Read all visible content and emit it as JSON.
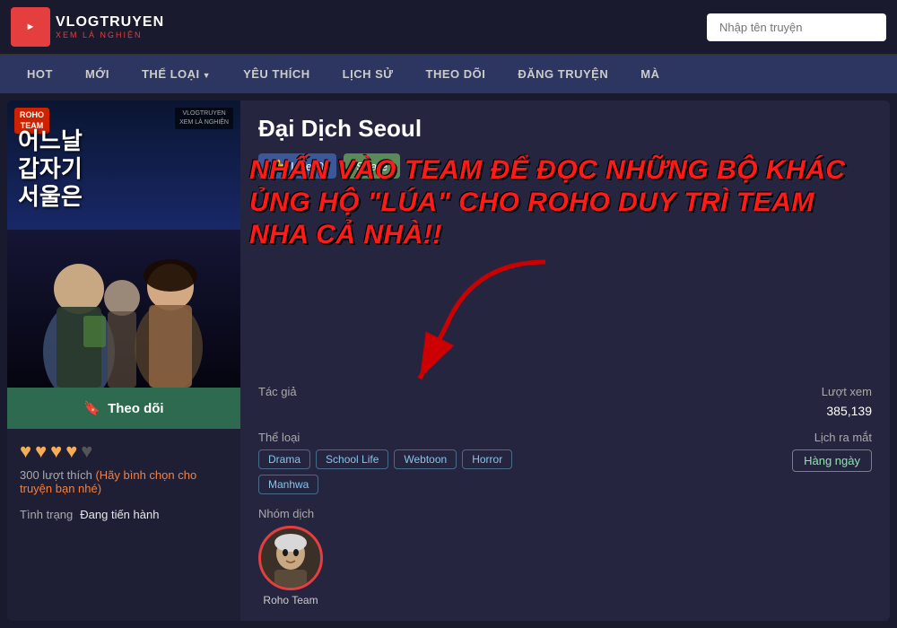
{
  "header": {
    "logo_line1": "VLOGTRUYEN",
    "logo_line2": "XEM LÀ NGHIỆN",
    "search_placeholder": "Nhập tên truyện"
  },
  "nav": {
    "items": [
      {
        "label": "HOT",
        "arrow": false
      },
      {
        "label": "MỚI",
        "arrow": false
      },
      {
        "label": "THỂ LOẠI",
        "arrow": true
      },
      {
        "label": "YÊU THÍCH",
        "arrow": false
      },
      {
        "label": "LỊCH SỬ",
        "arrow": false
      },
      {
        "label": "THEO DÕI",
        "arrow": false
      },
      {
        "label": "ĐĂNG TRUYỆN",
        "arrow": false
      },
      {
        "label": "MÀ",
        "arrow": false
      }
    ]
  },
  "manga": {
    "title": "Đại Dịch Seoul",
    "like_btn_label": "Like",
    "like_count": "0",
    "share_btn_label": "Share",
    "promo_text": "NHẤN VÀO TEAM ĐỂ ĐỌC NHỮNG BỘ KHÁC ỦNG HỘ \"LÚA\" CHO ROHO DUY TRÌ TEAM NHA CẢ NHÀ!!",
    "tac_gia_label": "Tác giả",
    "tac_gia_value": "",
    "luot_xem_label": "Lượt xem",
    "luot_xem_value": "385,139",
    "the_loai_label": "Thể loại",
    "tags": [
      "Drama",
      "School Life",
      "Webtoon",
      "Horror",
      "Manhwa"
    ],
    "nhom_dich_label": "Nhóm dịch",
    "nhom_dich_name": "Roho Team",
    "lich_ra_mat_label": "Lịch ra mắt",
    "lich_ra_mat_value": "Hàng ngày",
    "follow_btn": "Theo dõi",
    "hearts_filled": 4,
    "hearts_total": 5,
    "like_count_text": "300 lượt thích",
    "vote_prompt": "(Hãy bình chọn cho truyện bạn nhé)",
    "tinh_trang_label": "Tình trạng",
    "tinh_trang_value": "Đang tiến hành",
    "cover_label_line1": "ROHO",
    "cover_label_line2": "TEAM",
    "cover_korean": "어느날\n갑자기\n서울은",
    "cover_watermark_line1": "VLOGTRUYEN",
    "cover_watermark_line2": "XEM LÀ NGHIỆN"
  }
}
